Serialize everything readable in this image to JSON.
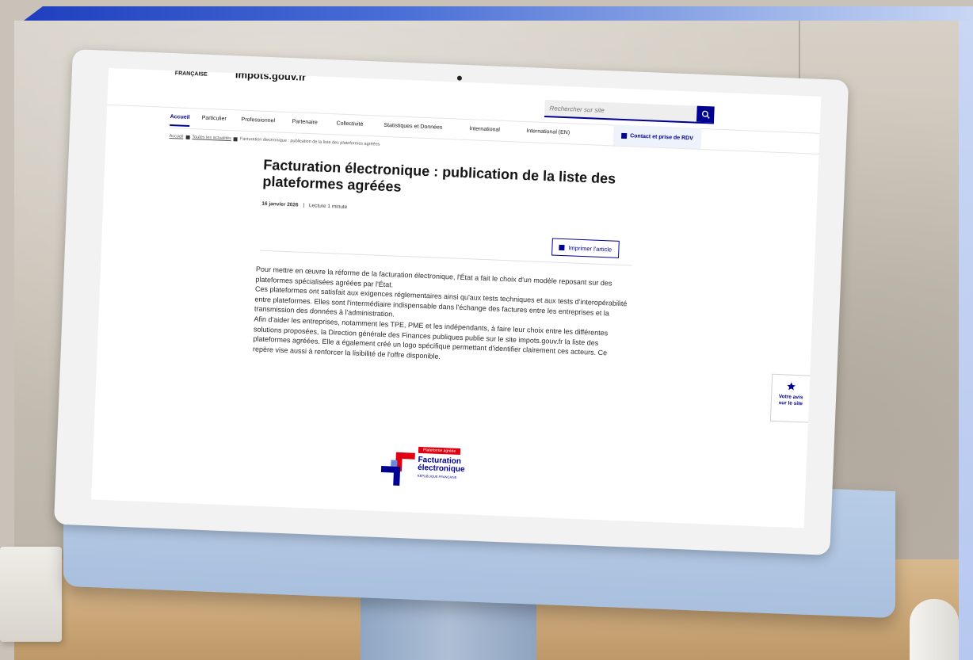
{
  "site": {
    "gov_mark": "FRANÇAISE",
    "name": "impots.gouv.fr"
  },
  "search": {
    "placeholder": "Rechercher sur site"
  },
  "nav": {
    "items": [
      "Accueil",
      "Particulier",
      "Professionnel",
      "Partenaire",
      "Collectivité",
      "Statistiques et Données",
      "International",
      "International (EN)"
    ],
    "active": "Accueil",
    "contact_label": "Contact et prise de RDV"
  },
  "breadcrumb": {
    "home": "Accueil",
    "section": "Toutes les actualités",
    "current": "Facturation électronique : publication de la liste des plateformes agréées"
  },
  "article": {
    "title": "Facturation électronique : publication de la liste des plateformes agréées",
    "date": "16 janvier 2026",
    "separator": "|",
    "reading_time": "Lecture 1 minute",
    "print_label": "Imprimer l'article",
    "paragraphs": [
      "Pour mettre en œuvre la réforme de la facturation électronique, l'État a fait le choix d'un modèle reposant sur des plateformes spécialisées agréées par l'État.",
      "Ces plateformes ont satisfait aux exigences réglementaires ainsi qu'aux tests techniques et aux tests d'interopérabilité entre plateformes. Elles sont l'intermédiaire indispensable dans l'échange des factures entre les entreprises et la transmission des données à l'administration.",
      "Afin d'aider les entreprises, notamment les TPE, PME et les indépendants, à faire leur choix entre les différentes solutions proposées, la Direction générale des Finances publiques publie sur le site impots.gouv.fr la liste des plateformes agréées. Elle a également créé un logo spécifique permettant d'identifier clairement ces acteurs. Ce repère vise aussi à renforcer la lisibilité de l'offre disponible."
    ]
  },
  "logo": {
    "badge": "Plateforme agréée",
    "line1": "Facturation",
    "line2": "électronique",
    "sub": "RÉPUBLIQUE FRANÇAISE"
  },
  "feedback": {
    "line1": "Votre avis",
    "line2": "sur le site"
  },
  "colors": {
    "brand_blue": "#000091",
    "marianne_red": "#e1000f"
  }
}
